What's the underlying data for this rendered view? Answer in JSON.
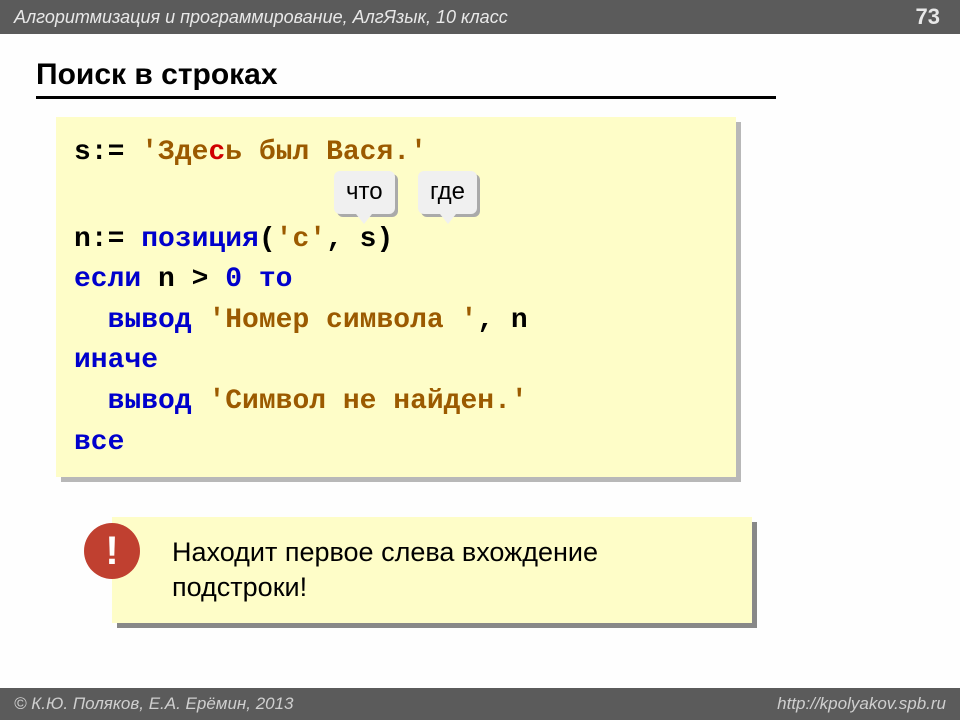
{
  "header": {
    "breadcrumb": "Алгоритмизация и программирование, АлгЯзык, 10 класс",
    "page": "73"
  },
  "title": "Поиск в строках",
  "code": {
    "l1_a": "s:= ",
    "l1_b": "'Зде",
    "l1_c": "с",
    "l1_d": "ь был Вася.'",
    "chip1": "что",
    "chip2": "где",
    "l2_a": "n:= ",
    "l2_b": "позиция",
    "l2_c": "(",
    "l2_d": "'с'",
    "l2_e": ", s)",
    "l3_a": "если",
    "l3_b": " n > ",
    "l3_c": "0",
    "l3_d": " ",
    "l3_e": "то",
    "l4_a": "  ",
    "l4_b": "вывод",
    "l4_c": " ",
    "l4_d": "'Номер символа '",
    "l4_e": ", n",
    "l5": "иначе",
    "l6_a": "  ",
    "l6_b": "вывод",
    "l6_c": " ",
    "l6_d": "'Символ не найден.'",
    "l7": "все"
  },
  "note": {
    "excl": "!",
    "text": "Находит первое слева вхождение подстроки!"
  },
  "footer": {
    "left": "© К.Ю. Поляков, Е.А. Ерёмин, 2013",
    "right": "http://kpolyakov.spb.ru"
  }
}
